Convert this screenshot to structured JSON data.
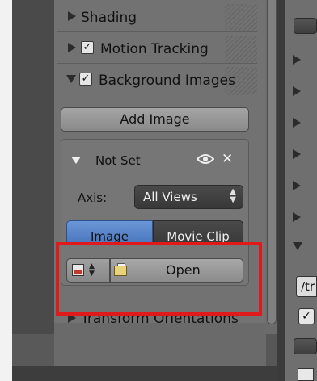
{
  "panel": {
    "headers": [
      {
        "label": "Shading",
        "has_checkbox": false,
        "expanded": false
      },
      {
        "label": "Motion Tracking",
        "has_checkbox": true,
        "checked": true,
        "expanded": false
      },
      {
        "label": "Background Images",
        "has_checkbox": true,
        "checked": true,
        "expanded": true
      }
    ],
    "add_image_label": "Add Image",
    "image_entry": {
      "title": "Not Set",
      "axis_label": "Axis:",
      "axis_value": "All Views",
      "source_tabs": [
        {
          "label": "Image",
          "active": true
        },
        {
          "label": "Movie Clip",
          "active": false
        }
      ],
      "open_label": "Open"
    },
    "next_header": "Transform Orientations"
  },
  "right_panel": {
    "path_prefix": "/tr"
  },
  "icons": {
    "checkmark": "✓",
    "eye": "👁",
    "close": "✕",
    "updown": "⬍"
  },
  "colors": {
    "highlight": "#e0191b",
    "active_tab": "#5a86ca"
  }
}
